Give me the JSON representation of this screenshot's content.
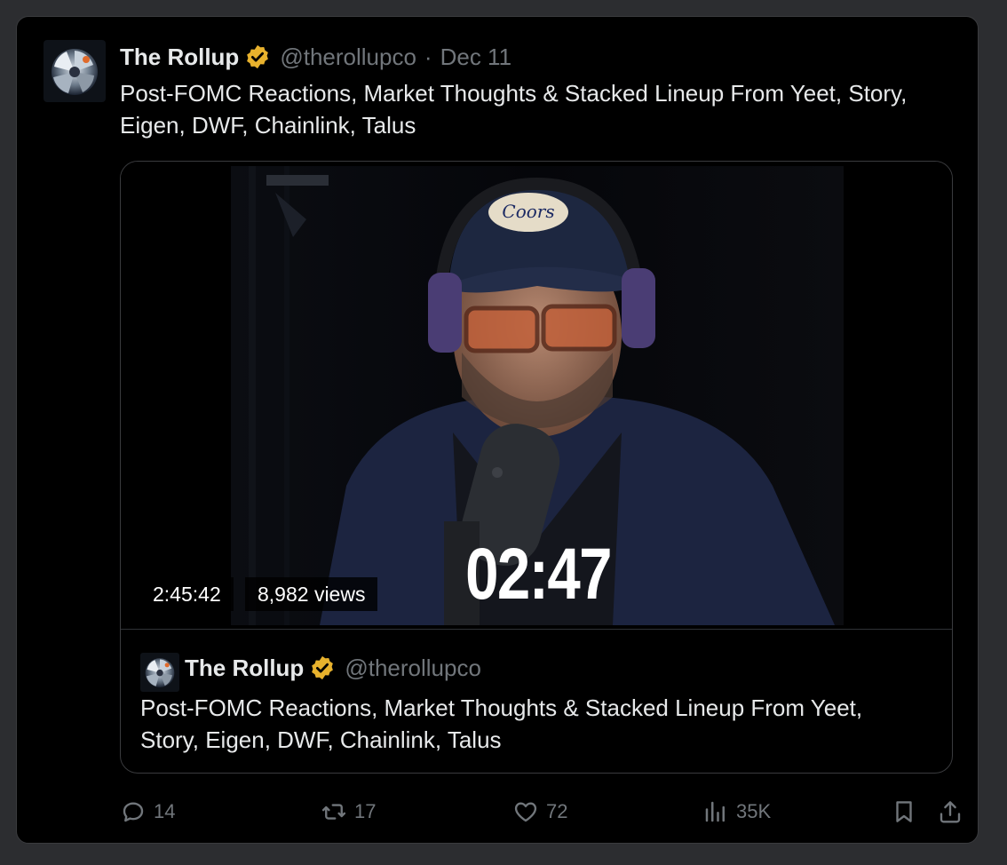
{
  "post": {
    "author_name": "The Rollup",
    "handle": "@therollupco",
    "separator": "·",
    "date": "Dec 11",
    "text": "Post-FOMC Reactions, Market Thoughts & Stacked Lineup From Yeet, Story, Eigen, DWF, Chainlink, Talus",
    "verified_color": "#e8b22d"
  },
  "video": {
    "duration": "2:45:42",
    "views": "8,982 views",
    "timer_overlay": "02:47",
    "cap_text": "Coors"
  },
  "quoted": {
    "author_name": "The Rollup",
    "handle": "@therollupco",
    "text": "Post-FOMC Reactions, Market Thoughts & Stacked Lineup From Yeet, Story, Eigen, DWF, Chainlink, Talus"
  },
  "actions": {
    "replies": "14",
    "reposts": "17",
    "likes": "72",
    "views": "35K",
    "icons": [
      "reply-icon",
      "repost-icon",
      "like-icon",
      "views-icon",
      "bookmark-icon",
      "share-icon"
    ]
  }
}
